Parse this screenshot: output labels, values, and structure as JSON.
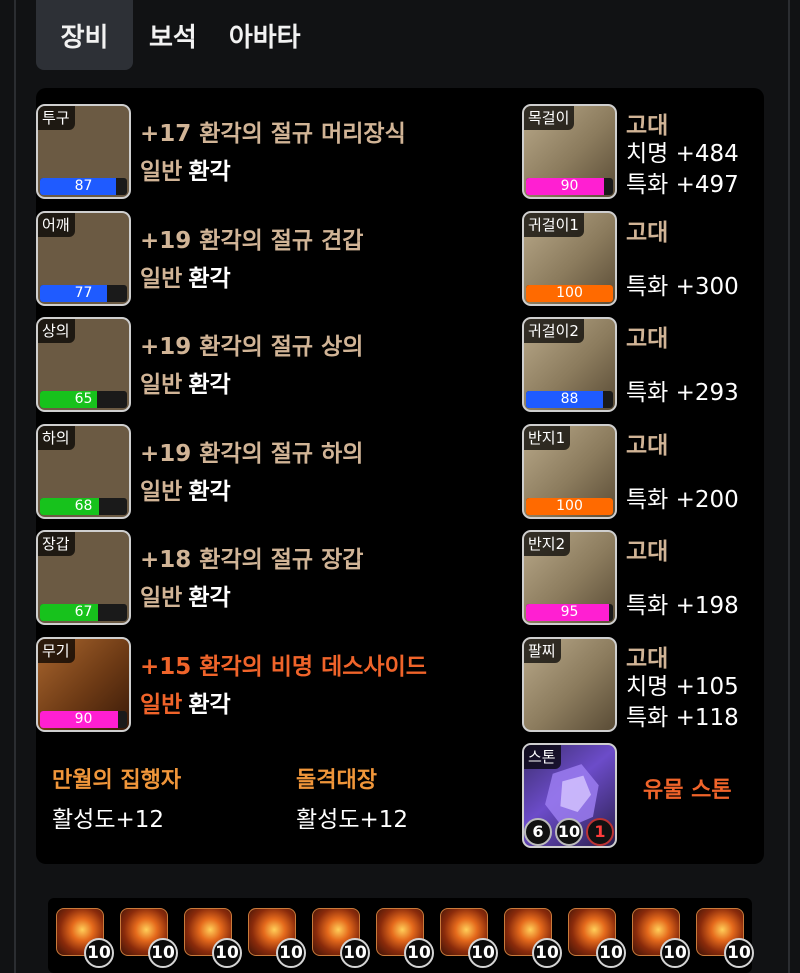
{
  "tabs": [
    {
      "label": "장비",
      "active": true
    },
    {
      "label": "보석",
      "active": false
    },
    {
      "label": "아바타",
      "active": false
    }
  ],
  "equipment": [
    {
      "slot": "투구",
      "quality": 87,
      "quality_color": "#1f5bff",
      "name": "+17 환각의 절규 머리장식",
      "grade": "일반",
      "set": "환각",
      "name_color": "#d1b496",
      "icon": "helmet-icon"
    },
    {
      "slot": "어깨",
      "quality": 77,
      "quality_color": "#1f5bff",
      "name": "+19 환각의 절규 견갑",
      "grade": "일반",
      "set": "환각",
      "name_color": "#d1b496",
      "icon": "shoulder-icon"
    },
    {
      "slot": "상의",
      "quality": 65,
      "quality_color": "#17c21c",
      "name": "+19 환각의 절규 상의",
      "grade": "일반",
      "set": "환각",
      "name_color": "#d1b496",
      "icon": "chest-armor-icon"
    },
    {
      "slot": "하의",
      "quality": 68,
      "quality_color": "#17c21c",
      "name": "+19 환각의 절규 하의",
      "grade": "일반",
      "set": "환각",
      "name_color": "#d1b496",
      "icon": "pants-icon"
    },
    {
      "slot": "장갑",
      "quality": 67,
      "quality_color": "#17c21c",
      "name": "+18 환각의 절규 장갑",
      "grade": "일반",
      "set": "환각",
      "name_color": "#d1b496",
      "icon": "gloves-icon"
    },
    {
      "slot": "무기",
      "quality": 90,
      "quality_color": "#ff1fd2",
      "name": "+15 환각의 비명 데스사이드",
      "grade": "일반",
      "set": "환각",
      "name_color": "#f0642a",
      "icon": "scythe-icon"
    }
  ],
  "accessories": [
    {
      "slot": "목걸이",
      "quality": 90,
      "quality_color": "#ff1fd2",
      "grade": "고대",
      "stats": [
        "치명 +484",
        "특화 +497"
      ],
      "icon": "necklace-icon"
    },
    {
      "slot": "귀걸이1",
      "quality": 100,
      "quality_color": "#ff6a00",
      "grade": "고대",
      "stats": [
        "특화 +300"
      ],
      "icon": "earring-icon"
    },
    {
      "slot": "귀걸이2",
      "quality": 88,
      "quality_color": "#1f5bff",
      "grade": "고대",
      "stats": [
        "특화 +293"
      ],
      "icon": "earring-icon"
    },
    {
      "slot": "반지1",
      "quality": 100,
      "quality_color": "#ff6a00",
      "grade": "고대",
      "stats": [
        "특화 +200"
      ],
      "icon": "ring-icon"
    },
    {
      "slot": "반지2",
      "quality": 95,
      "quality_color": "#ff1fd2",
      "grade": "고대",
      "stats": [
        "특화 +198"
      ],
      "icon": "ring-icon"
    },
    {
      "slot": "팔찌",
      "quality": null,
      "quality_color": null,
      "grade": "고대",
      "stats": [
        "치명 +105",
        "특화 +118"
      ],
      "icon": "bracelet-icon"
    }
  ],
  "stone": {
    "slot": "스톤",
    "label": "유물 스톤",
    "values": [
      "6",
      "10",
      "1"
    ],
    "icon": "ability-stone-icon"
  },
  "engravings": [
    {
      "name": "만월의 집행자",
      "value": "활성도+12"
    },
    {
      "name": "돌격대장",
      "value": "활성도+12"
    }
  ],
  "gems": [
    {
      "level": "10"
    },
    {
      "level": "10"
    },
    {
      "level": "10"
    },
    {
      "level": "10"
    },
    {
      "level": "10"
    },
    {
      "level": "10"
    },
    {
      "level": "10"
    },
    {
      "level": "10"
    },
    {
      "level": "10"
    },
    {
      "level": "10"
    },
    {
      "level": "10"
    }
  ]
}
